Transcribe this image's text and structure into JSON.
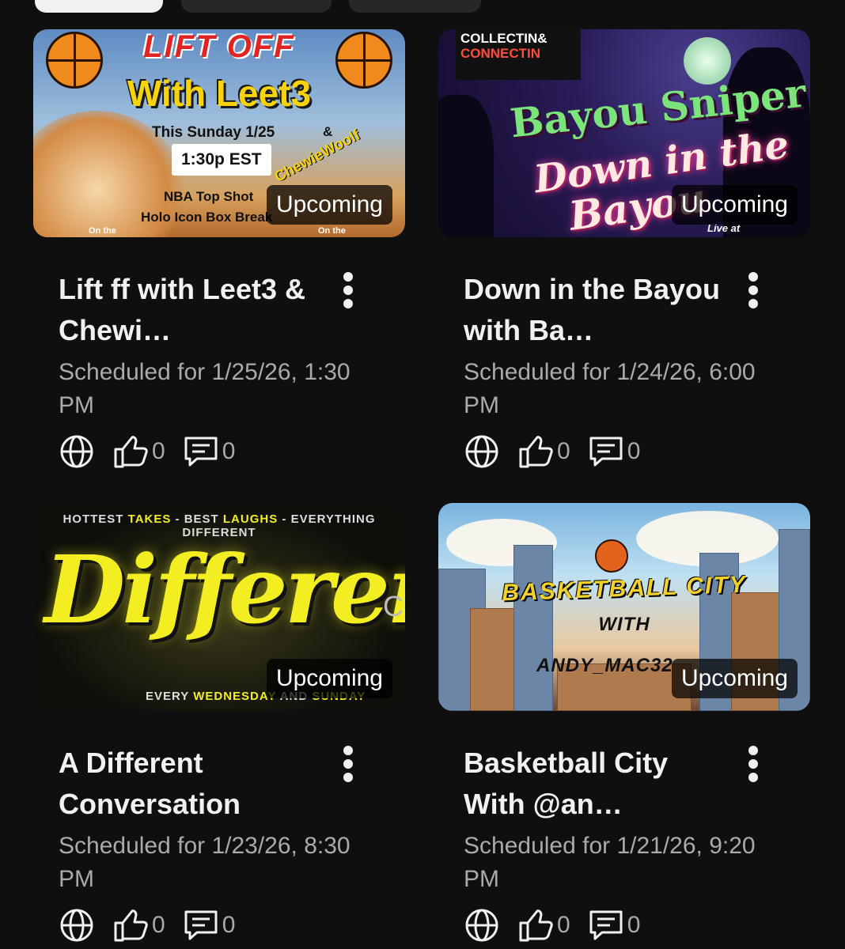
{
  "filter_chips": [
    {
      "label": "",
      "active": true
    },
    {
      "label": "",
      "active": false
    },
    {
      "label": "",
      "active": false
    }
  ],
  "badge_label": "Upcoming",
  "videos": [
    {
      "title": "Lift ff with Leet3 & Chewi…",
      "scheduled": "Scheduled for 1/25/26, 1:30 PM",
      "likes": "0",
      "comments": "0",
      "thumbnail": {
        "line1": "LIFT OFF",
        "line2": "With Leet3",
        "line3": "This Sunday 1/25",
        "time": "1:30p EST",
        "amp": "&",
        "guest": "ChewieWoolf",
        "line4": "NBA Top Shot",
        "line5": "Holo Icon Box Break",
        "foot_left": "On the",
        "foot_right": "On the"
      }
    },
    {
      "title": "Down in the Bayou with Ba…",
      "scheduled": "Scheduled for 1/24/26, 6:00 PM",
      "likes": "0",
      "comments": "0",
      "thumbnail": {
        "logo_line1": "COLLECTIN&",
        "logo_line2": "CONNECTIN",
        "line1": "Bayou Sniper",
        "line2": "Down in the",
        "line3": "Bayou",
        "foot": "Live at"
      }
    },
    {
      "title": "A Different Conversation",
      "scheduled": "Scheduled for 1/23/26, 8:30 PM",
      "likes": "0",
      "comments": "0",
      "thumbnail": {
        "top_a": "HOTTEST",
        "top_b": "TAKES",
        "top_c": " - BEST",
        "top_d": "LAUGHS",
        "top_e": " - EVERYTHING DIFFERENT",
        "big": "Different",
        "trail": "C",
        "bottom_a": "EVERY",
        "bottom_b": "WEDNESDAY",
        "bottom_c": " AND",
        "bottom_d": "SUNDAY"
      }
    },
    {
      "title": "Basketball City With @an…",
      "scheduled": "Scheduled for 1/21/26, 9:20 PM",
      "likes": "0",
      "comments": "0",
      "thumbnail": {
        "line1": "BASKETBALL CITY",
        "line2": "WITH",
        "line3": "ANDY_MAC32"
      }
    }
  ],
  "icons": {
    "visibility": "globe-icon",
    "likes": "thumbs-up-icon",
    "comments": "comment-icon",
    "more": "more-vertical-icon"
  },
  "colors": {
    "background": "#0f0f0f",
    "text_primary": "#f1f1f1",
    "text_secondary": "#aaaaaa",
    "badge_bg": "#000000"
  }
}
